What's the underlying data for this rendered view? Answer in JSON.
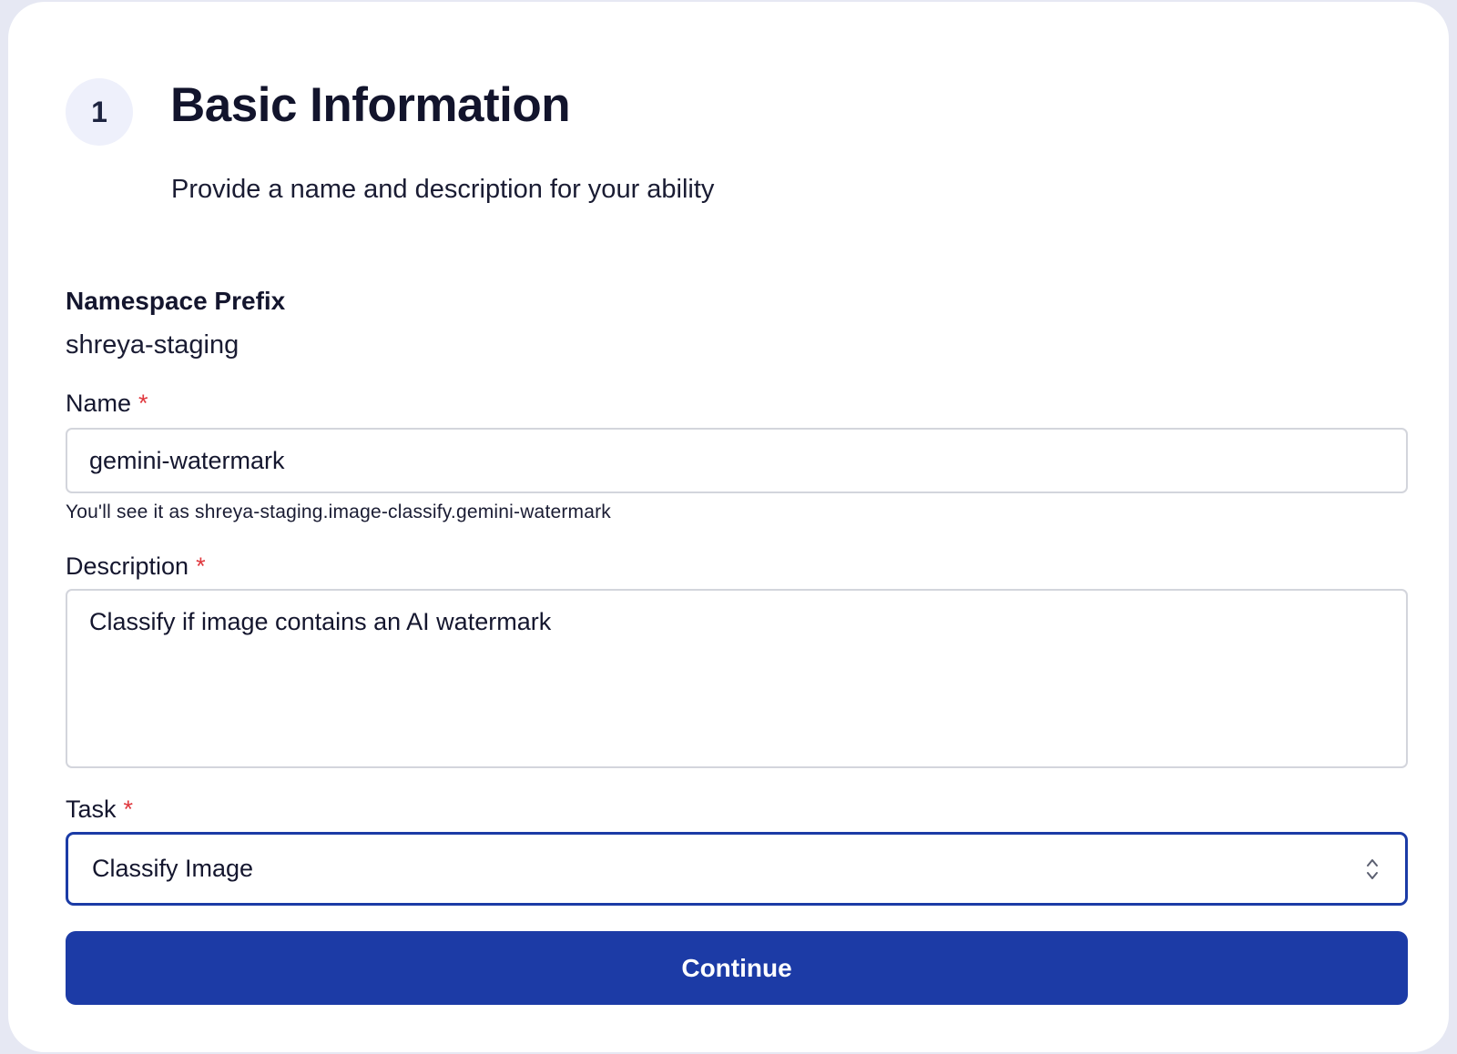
{
  "step": {
    "number": "1",
    "title": "Basic Information",
    "subtitle": "Provide a name and description for your ability"
  },
  "namespace": {
    "label": "Namespace Prefix",
    "value": "shreya-staging"
  },
  "name_field": {
    "label": "Name",
    "required_marker": "*",
    "value": "gemini-watermark",
    "helper": "You'll see it as shreya-staging.image-classify.gemini-watermark"
  },
  "description_field": {
    "label": "Description",
    "required_marker": "*",
    "value": "Classify if image contains an AI watermark"
  },
  "task_field": {
    "label": "Task",
    "required_marker": "*",
    "selected": "Classify Image",
    "icon": "chevron-up-down-icon"
  },
  "actions": {
    "continue_label": "Continue"
  },
  "colors": {
    "primary": "#1c3ba6",
    "required": "#e0383e",
    "badge_bg": "#eef0fb",
    "page_bg": "#e6e8f3"
  }
}
